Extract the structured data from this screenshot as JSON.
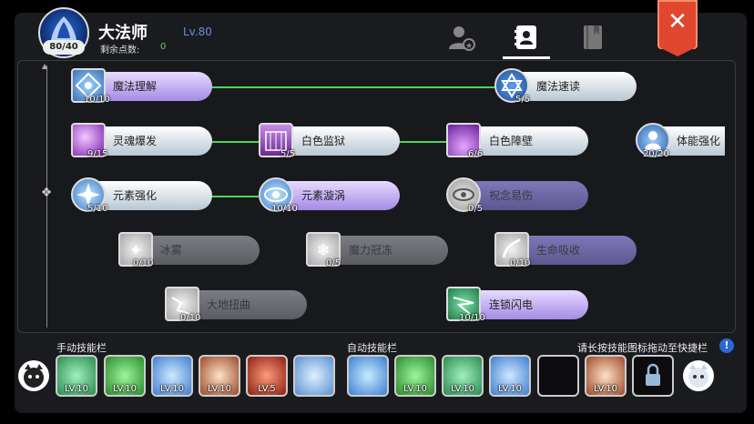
{
  "header": {
    "class_name": "大法师",
    "level": "Lv.80",
    "avatar_level": "80/40",
    "skill_points_label": "剩余点数:",
    "skill_points_value": "0",
    "close_label": "✕",
    "tabs": [
      "profile",
      "skills",
      "book"
    ]
  },
  "skills": [
    {
      "name": "魔法理解",
      "level": "10/10"
    },
    {
      "name": "魔法速读",
      "level": "5/5"
    },
    {
      "name": "灵魂爆发",
      "level": "9/15"
    },
    {
      "name": "白色监狱",
      "level": "5/5"
    },
    {
      "name": "白色障壁",
      "level": "6/6"
    },
    {
      "name": "体能强化",
      "level": "20/20"
    },
    {
      "name": "元素强化",
      "level": "5/10"
    },
    {
      "name": "元素漩涡",
      "level": "10/10"
    },
    {
      "name": "祝念易伤",
      "level": "0/5"
    },
    {
      "name": "冰雾",
      "level": "0/10"
    },
    {
      "name": "魔力冠冻",
      "level": "0/5"
    },
    {
      "name": "生命吸收",
      "level": "0/10"
    },
    {
      "name": "大地扭曲",
      "level": "0/10"
    },
    {
      "name": "连锁闪电",
      "level": "10/10"
    }
  ],
  "bottom": {
    "manual_label": "手动技能栏",
    "auto_label": "自动技能栏",
    "hint": "请长按技能图标拖动至快捷栏",
    "manual_slots": [
      "LV.10",
      "LV.10",
      "LV.10",
      "LV.10",
      "LV.5",
      ""
    ],
    "auto_slots": [
      "",
      "LV.10",
      "LV.10",
      "LV.10",
      "",
      "LV.10",
      ""
    ]
  },
  "colors": {
    "accent_green": "#4fd45a",
    "close_red": "#e0472e",
    "level_blue": "#6b8fd6"
  }
}
